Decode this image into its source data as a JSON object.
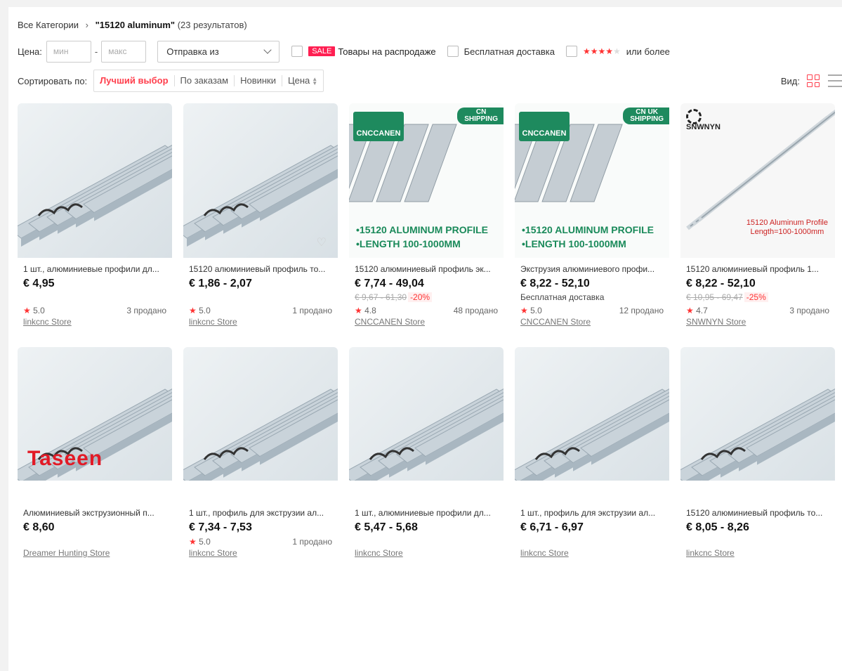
{
  "breadcrumb": {
    "root": "Все Категории",
    "separator": "›",
    "query": "\"15120 aluminum\"",
    "count": "(23 результатов)"
  },
  "filters": {
    "price_label": "Цена:",
    "min_placeholder": "мин",
    "max_placeholder": "макс",
    "dash": "-",
    "ship_from": "Отправка из",
    "sale_badge": "SALE",
    "sale_text": "Товары на распродаже",
    "free_shipping": "Бесплатная доставка",
    "rating_stars": "★★★★",
    "rating_star_off": "★",
    "rating_text": "или более"
  },
  "sort": {
    "label": "Сортировать по:",
    "options": [
      "Лучший выбор",
      "По заказам",
      "Новинки",
      "Цена"
    ],
    "active_index": 0
  },
  "view": {
    "label": "Вид:"
  },
  "colors": {
    "accent": "#ff3e4c",
    "rating_star": "#ff3333",
    "brand_green": "#1e8a5e"
  },
  "products": [
    {
      "title": "1 шт., алюминиевые профили дл...",
      "price": "€ 4,95",
      "rating": "5.0",
      "sold": "3 продано",
      "store": "linkcnc Store"
    },
    {
      "title": "15120 алюминиевый профиль то...",
      "price": "€ 1,86 - 2,07",
      "rating": "5.0",
      "sold": "1 продано",
      "store": "linkcnc Store"
    },
    {
      "title": "15120 алюминиевый профиль эк...",
      "price": "€ 7,74 - 49,04",
      "old_price": "€ 9,67 - 61,30",
      "discount": "-20%",
      "rating": "4.8",
      "sold": "48 продано",
      "store": "CNCCANEN Store",
      "brand": "CNCCANEN",
      "ship_badge": [
        "CN",
        "SHIPPING"
      ],
      "promo": [
        "•15120 ALUMINUM PROFILE",
        "•LENGTH 100-1000MM"
      ]
    },
    {
      "title": "Экструзия алюминиевого профи...",
      "price": "€ 8,22 - 52,10",
      "free_shipping": "Бесплатная доставка",
      "rating": "5.0",
      "sold": "12 продано",
      "store": "CNCCANEN Store",
      "brand": "CNCCANEN",
      "ship_badge": [
        "CN UK",
        "SHIPPING"
      ],
      "promo": [
        "•15120 ALUMINUM PROFILE",
        "•LENGTH 100-1000MM"
      ]
    },
    {
      "title": "15120 алюминиевый профиль 1...",
      "price": "€ 8,22 - 52,10",
      "old_price": "€ 10,95 - 69,47",
      "discount": "-25%",
      "rating": "4.7",
      "sold": "3 продано",
      "store": "SNWNYN Store",
      "brand": "SNWNYN",
      "caption": [
        "15120 Aluminum Profile",
        "Length=100-1000mm"
      ]
    },
    {
      "title": "Алюминиевый экструзионный п...",
      "price": "€ 8,60",
      "store": "Dreamer Hunting Store",
      "brand": "Taseen"
    },
    {
      "title": "1 шт., профиль для экструзии ал...",
      "price": "€ 7,34 - 7,53",
      "rating": "5.0",
      "sold": "1 продано",
      "store": "linkcnc Store"
    },
    {
      "title": "1 шт., алюминиевые профили дл...",
      "price": "€ 5,47 - 5,68",
      "store": "linkcnc Store"
    },
    {
      "title": "1 шт., профиль для экструзии ал...",
      "price": "€ 6,71 - 6,97",
      "store": "linkcnc Store"
    },
    {
      "title": "15120 алюминиевый профиль то...",
      "price": "€ 8,05 - 8,26",
      "store": "linkcnc Store"
    }
  ]
}
